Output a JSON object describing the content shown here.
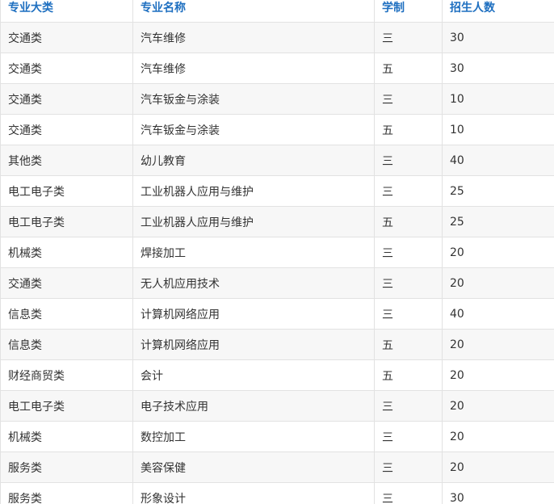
{
  "table": {
    "headers": [
      "专业大类",
      "专业名称",
      "学制",
      "招生人数"
    ],
    "rows": [
      [
        "交通类",
        "汽车维修",
        "三",
        "30"
      ],
      [
        "交通类",
        "汽车维修",
        "五",
        "30"
      ],
      [
        "交通类",
        "汽车钣金与涂装",
        "三",
        "10"
      ],
      [
        "交通类",
        "汽车钣金与涂装",
        "五",
        "10"
      ],
      [
        "其他类",
        "幼儿教育",
        "三",
        "40"
      ],
      [
        "电工电子类",
        "工业机器人应用与维护",
        "三",
        "25"
      ],
      [
        "电工电子类",
        "工业机器人应用与维护",
        "五",
        "25"
      ],
      [
        "机械类",
        "焊接加工",
        "三",
        "20"
      ],
      [
        "交通类",
        "无人机应用技术",
        "三",
        "20"
      ],
      [
        "信息类",
        "计算机网络应用",
        "三",
        "40"
      ],
      [
        "信息类",
        "计算机网络应用",
        "五",
        "20"
      ],
      [
        "财经商贸类",
        "会计",
        "五",
        "20"
      ],
      [
        "电工电子类",
        "电子技术应用",
        "三",
        "20"
      ],
      [
        "机械类",
        "数控加工",
        "三",
        "20"
      ],
      [
        "服务类",
        "美容保健",
        "三",
        "20"
      ],
      [
        "服务类",
        "形象设计",
        "三",
        "30"
      ]
    ]
  }
}
